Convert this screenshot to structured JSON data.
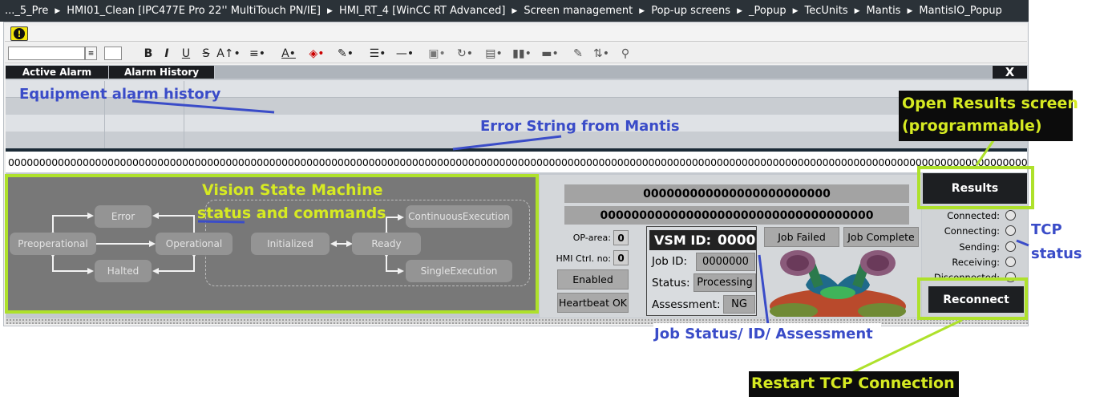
{
  "breadcrumb": [
    "..._5_Pre",
    "HMI01_Clean [IPC477E Pro 22'' MultiTouch PN/IE]",
    "HMI_RT_4 [WinCC RT Advanced]",
    "Screen management",
    "Pop-up screens",
    "_Popup",
    "TecUnits",
    "Mantis",
    "MantisIO_Popup"
  ],
  "toolbar": {
    "warning_symbol": "!",
    "bold": "B",
    "italic": "I",
    "underline": "U",
    "strike": "S",
    "icons": [
      "bold-icon",
      "italic-icon",
      "underline-icon",
      "strikethrough-icon",
      "font-size-icon",
      "align-icon",
      "font-color-icon",
      "fill-color-icon",
      "line-color-icon",
      "line-width-icon",
      "line-style-icon",
      "arrange-icon",
      "rotate-icon",
      "align-objects-icon",
      "distribute-icon",
      "paint-icon",
      "tab-order-icon",
      "zoom-icon"
    ]
  },
  "alarm_view": {
    "tab_active": "Active Alarm",
    "tab_history": "Alarm History",
    "close_label": "X"
  },
  "error_string": "000000000000000000000000000000000000000000000000000000000000000000000000000000000000000000000000000000000000000000000000000000000000000000000000000000000000000000000",
  "state_machine": {
    "states": [
      "Error",
      "Preoperational",
      "Operational",
      "Halted",
      "Initialized",
      "Ready",
      "ContinuousExecution",
      "SingleExecution"
    ]
  },
  "info": {
    "field1": "000000000000000000000000",
    "field2": "00000000000000000000000000000000000",
    "op_area_label": "OP-area:",
    "op_area_value": "0",
    "hmi_ctrl_label": "HMI Ctrl. no:",
    "hmi_ctrl_value": "0",
    "enabled_label": "Enabled",
    "heartbeat_label": "Heartbeat OK",
    "vsm_id_label": "VSM ID:",
    "vsm_id_value": "0000",
    "job_id_label": "Job ID:",
    "job_id_value": "0000000",
    "status_label": "Status:",
    "status_value": "Processing",
    "assessment_label": "Assessment:",
    "assessment_value": "NG",
    "job_failed": "Job Failed",
    "job_complete": "Job Complete"
  },
  "tcp": {
    "results_label": "Results",
    "reconnect_label": "Reconnect",
    "states": [
      "Connected:",
      "Connecting:",
      "Sending:",
      "Receiving:",
      "Disconnected:"
    ]
  },
  "annotations": {
    "equipment_alarm_history": "Equipment alarm history",
    "error_string": "Error String from Mantis",
    "vision_state_machine_1": "Vision State Machine",
    "vision_state_machine_2a": "status",
    "vision_state_machine_2b": " and commands",
    "job_status": "Job Status/ ID/ Assessment",
    "open_results_1": "Open Results screen",
    "open_results_2": "(programmable)",
    "tcp_status_1": "TCP",
    "tcp_status_2": "status",
    "restart_tcp": "Restart TCP Connection"
  },
  "colors": {
    "annotation_blue": "#3a4cc8",
    "annotation_yellow": "#d6ea22",
    "highlight_green": "#aee12b"
  }
}
